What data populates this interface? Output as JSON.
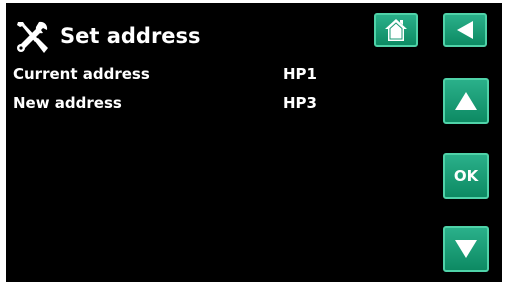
{
  "header": {
    "title": "Set address",
    "icon": "tools-icon"
  },
  "nav": {
    "home_icon": "home-icon",
    "back_icon": "back-arrow-icon"
  },
  "rows": [
    {
      "label": "Current address",
      "value": "HP1"
    },
    {
      "label": "New address",
      "value": "HP3"
    }
  ],
  "controls": {
    "up_icon": "up-arrow-icon",
    "ok_label": "OK",
    "down_icon": "down-arrow-icon"
  },
  "colors": {
    "background": "#000000",
    "button": "#17a07a",
    "button_border": "#4fd2a8",
    "text": "#ffffff"
  }
}
